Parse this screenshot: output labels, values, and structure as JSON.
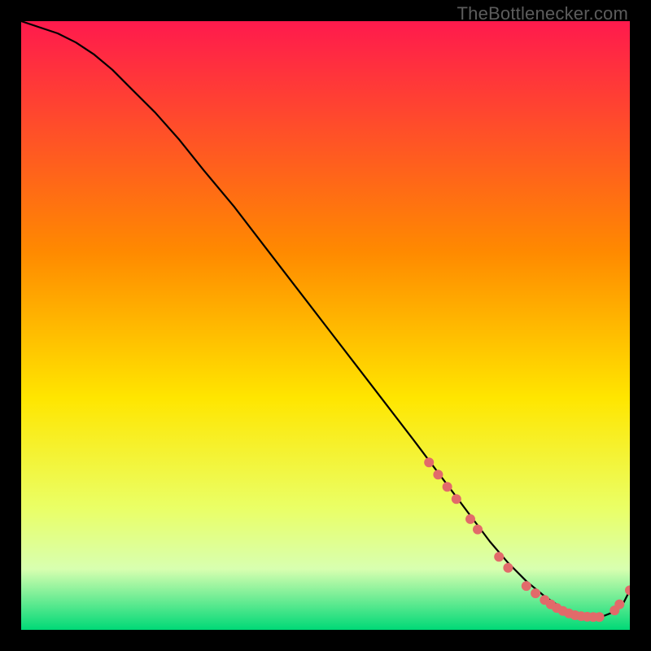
{
  "watermark": "TheBottlenecker.com",
  "chart_data": {
    "type": "line",
    "title": "",
    "xlabel": "",
    "ylabel": "",
    "xlim": [
      0,
      100
    ],
    "ylim": [
      0,
      100
    ],
    "background_gradient": {
      "top": "#ff1a4d",
      "mid_upper": "#ff8a00",
      "mid": "#ffe600",
      "mid_lower": "#eaff66",
      "bottom": "#00d977"
    },
    "series": [
      {
        "name": "bottleneck-curve",
        "color": "#000000",
        "x": [
          0,
          3,
          6,
          9,
          12,
          15,
          18,
          22,
          26,
          30,
          35,
          40,
          45,
          50,
          55,
          60,
          65,
          68,
          71,
          74,
          77,
          80,
          83,
          86,
          89,
          92,
          95,
          97,
          99,
          100
        ],
        "y": [
          100,
          99,
          98,
          96.5,
          94.5,
          92,
          89,
          85,
          80.5,
          75.5,
          69.5,
          63,
          56.5,
          50,
          43.5,
          37,
          30.5,
          26.5,
          22.5,
          18.5,
          14.5,
          11,
          8,
          5.5,
          3.5,
          2.3,
          2.0,
          2.8,
          4.5,
          6.5
        ]
      }
    ],
    "markers": {
      "name": "highlight-points",
      "color": "#e26a6a",
      "points": [
        {
          "x": 67,
          "y": 27.5
        },
        {
          "x": 68.5,
          "y": 25.5
        },
        {
          "x": 70,
          "y": 23.5
        },
        {
          "x": 71.5,
          "y": 21.5
        },
        {
          "x": 73.8,
          "y": 18.2
        },
        {
          "x": 75,
          "y": 16.5
        },
        {
          "x": 78.5,
          "y": 12
        },
        {
          "x": 80,
          "y": 10.2
        },
        {
          "x": 83,
          "y": 7.2
        },
        {
          "x": 84.5,
          "y": 6.0
        },
        {
          "x": 86,
          "y": 4.9
        },
        {
          "x": 87,
          "y": 4.2
        },
        {
          "x": 88,
          "y": 3.6
        },
        {
          "x": 89,
          "y": 3.1
        },
        {
          "x": 90,
          "y": 2.7
        },
        {
          "x": 91,
          "y": 2.4
        },
        {
          "x": 92,
          "y": 2.25
        },
        {
          "x": 93,
          "y": 2.15
        },
        {
          "x": 94,
          "y": 2.1
        },
        {
          "x": 95,
          "y": 2.1
        },
        {
          "x": 97.5,
          "y": 3.2
        },
        {
          "x": 98.3,
          "y": 4.2
        },
        {
          "x": 100,
          "y": 6.5
        }
      ]
    }
  }
}
